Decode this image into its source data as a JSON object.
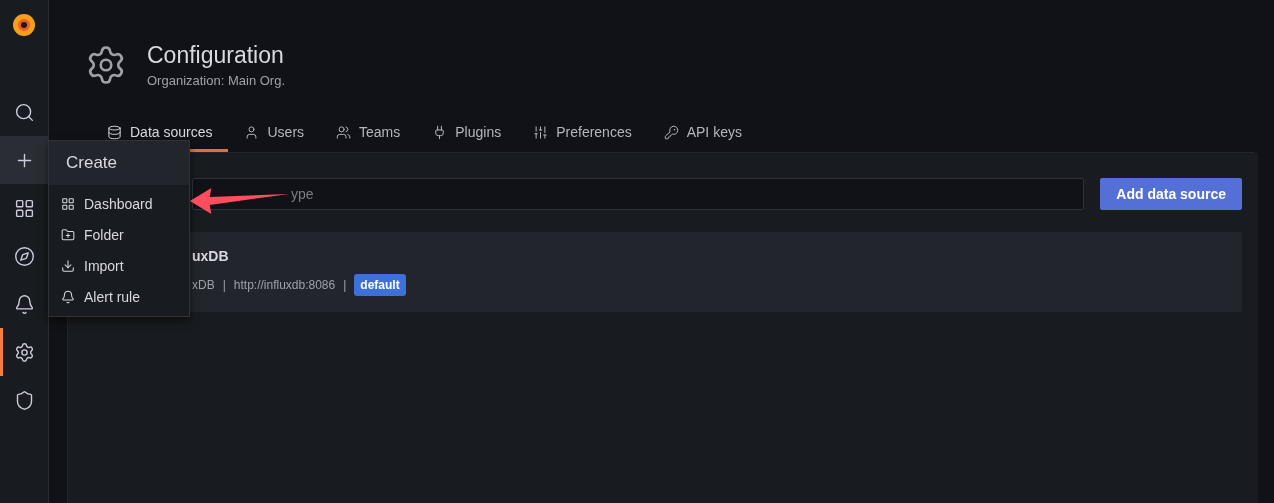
{
  "sidebar": {
    "items": [
      {
        "kind": "search",
        "selected": false,
        "expanded": false
      },
      {
        "kind": "create",
        "selected": false,
        "expanded": true
      },
      {
        "kind": "dashboards",
        "selected": false,
        "expanded": false
      },
      {
        "kind": "explore",
        "selected": false,
        "expanded": false
      },
      {
        "kind": "alerting",
        "selected": false,
        "expanded": false
      },
      {
        "kind": "configuration",
        "selected": true,
        "expanded": false
      },
      {
        "kind": "admin",
        "selected": false,
        "expanded": false
      }
    ]
  },
  "header": {
    "title": "Configuration",
    "subtitle": "Organization: Main Org."
  },
  "tabs": [
    {
      "kind": "datasources",
      "label": "Data sources",
      "selected": true
    },
    {
      "kind": "users",
      "label": "Users",
      "selected": false
    },
    {
      "kind": "teams",
      "label": "Teams",
      "selected": false
    },
    {
      "kind": "plugins",
      "label": "Plugins",
      "selected": false
    },
    {
      "kind": "preferences",
      "label": "Preferences",
      "selected": false
    },
    {
      "kind": "apikeys",
      "label": "API keys",
      "selected": false
    }
  ],
  "search": {
    "placeholder": "ype"
  },
  "add_button": "Add data source",
  "datasources": [
    {
      "name": "uxDB",
      "type": "xDB",
      "separator": "|",
      "url": "http://influxdb:8086",
      "separator_2": "|",
      "badge": "default"
    }
  ],
  "create_menu": {
    "title": "Create",
    "items": [
      {
        "kind": "dashboard",
        "label": "Dashboard"
      },
      {
        "kind": "folder",
        "label": "Folder"
      },
      {
        "kind": "import",
        "label": "Import"
      },
      {
        "kind": "alert",
        "label": "Alert rule"
      }
    ]
  }
}
